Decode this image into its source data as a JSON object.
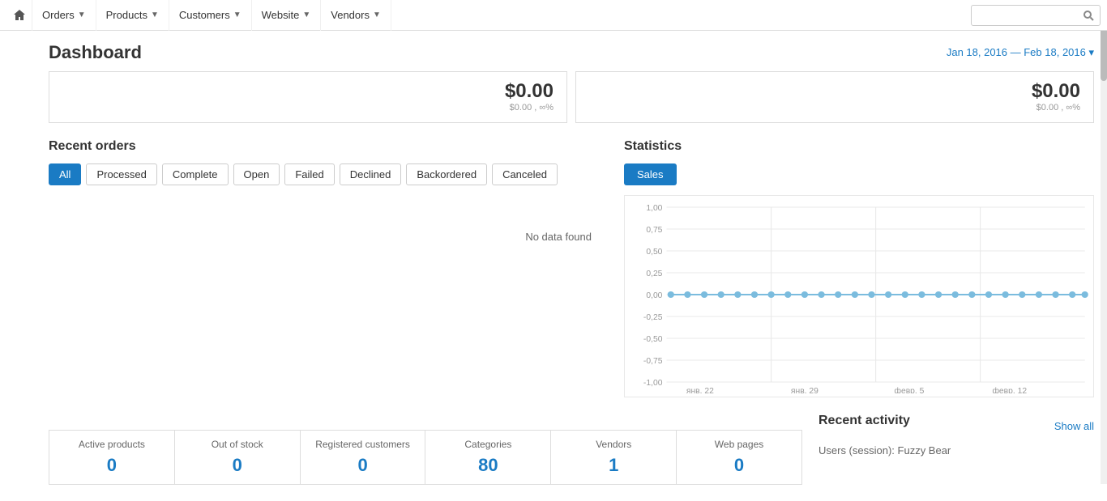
{
  "nav": {
    "home_icon": "⌂",
    "items": [
      {
        "label": "Orders",
        "id": "orders"
      },
      {
        "label": "Products",
        "id": "products"
      },
      {
        "label": "Customers",
        "id": "customers"
      },
      {
        "label": "Website",
        "id": "website"
      },
      {
        "label": "Vendors",
        "id": "vendors"
      }
    ],
    "search_placeholder": ""
  },
  "header": {
    "title": "Dashboard",
    "date_range": "Jan 18, 2016 — Feb 18, 2016 ▾"
  },
  "top_cards": [
    {
      "value": "$0.00",
      "sub": "$0.00 , ∞%"
    },
    {
      "value": "$0.00",
      "sub": "$0.00 , ∞%"
    }
  ],
  "recent_orders": {
    "title": "Recent orders",
    "filters": [
      {
        "label": "All",
        "active": true
      },
      {
        "label": "Processed",
        "active": false
      },
      {
        "label": "Complete",
        "active": false
      },
      {
        "label": "Open",
        "active": false
      },
      {
        "label": "Failed",
        "active": false
      },
      {
        "label": "Declined",
        "active": false
      },
      {
        "label": "Backordered",
        "active": false
      },
      {
        "label": "Canceled",
        "active": false
      }
    ],
    "no_data": "No data found"
  },
  "statistics": {
    "title": "Statistics",
    "button": "Sales",
    "chart": {
      "y_labels": [
        "1,00",
        "0,75",
        "0,50",
        "0,25",
        "0,00",
        "-0,25",
        "-0,50",
        "-0,75",
        "-1,00"
      ],
      "x_labels": [
        "янв. 22",
        "янв. 29",
        "февр. 5",
        "февр. 12"
      ]
    }
  },
  "bottom_stats": [
    {
      "label": "Active products",
      "value": "0"
    },
    {
      "label": "Out of stock",
      "value": "0"
    },
    {
      "label": "Registered customers",
      "value": "0"
    },
    {
      "label": "Categories",
      "value": "80"
    },
    {
      "label": "Vendors",
      "value": "1"
    },
    {
      "label": "Web pages",
      "value": "0"
    }
  ],
  "recent_activity": {
    "title": "Recent activity",
    "show_all": "Show all",
    "items": [
      {
        "text": "Users (session): Fuzzy Bear"
      }
    ]
  }
}
